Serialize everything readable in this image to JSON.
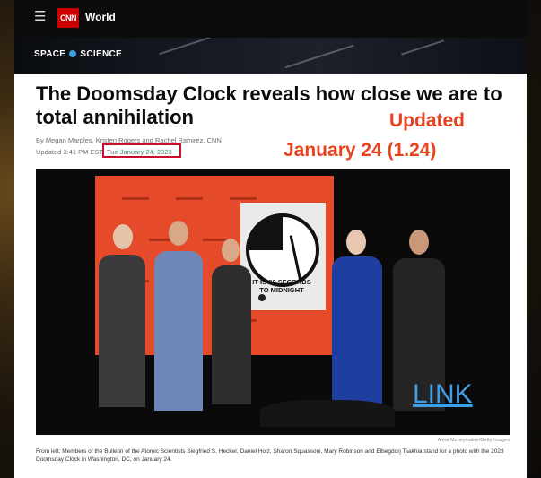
{
  "topbar": {
    "logo": "CNN",
    "section": "World"
  },
  "banner": {
    "label_part1": "SPACE",
    "label_part2": "SCIENCE"
  },
  "article": {
    "headline": "The Doomsday Clock reveals how close we are to total annihilation",
    "byline": "By Megan Marples, Kristen Rogers and Rachel Ramirez, CNN",
    "updated_prefix": "Updated 3:41 PM EST,",
    "updated_date": "Tue January 24, 2023"
  },
  "annotation": {
    "line1": "Updated",
    "line2": "January 24 (1.24)",
    "color": "#e8431e",
    "box_color": "#c8102e"
  },
  "photo": {
    "clock_line1": "IT IS 90 SECONDS",
    "clock_line2": "TO MIDNIGHT",
    "credit": "Anna Moneymaker/Getty Images",
    "link_label": "LINK"
  },
  "caption": "From left: Members of the Bulletin of the Atomic Scientists Siegfried S. Hecker, Daniel Holz, Sharon Squassoni, Mary Robinson and Elbegdorj Tsakhia stand for a photo with the 2023 Doomsday Clock in Washington, DC, on January 24.",
  "icons": {
    "menu": "hamburger-menu-icon",
    "globe": "globe-icon"
  }
}
